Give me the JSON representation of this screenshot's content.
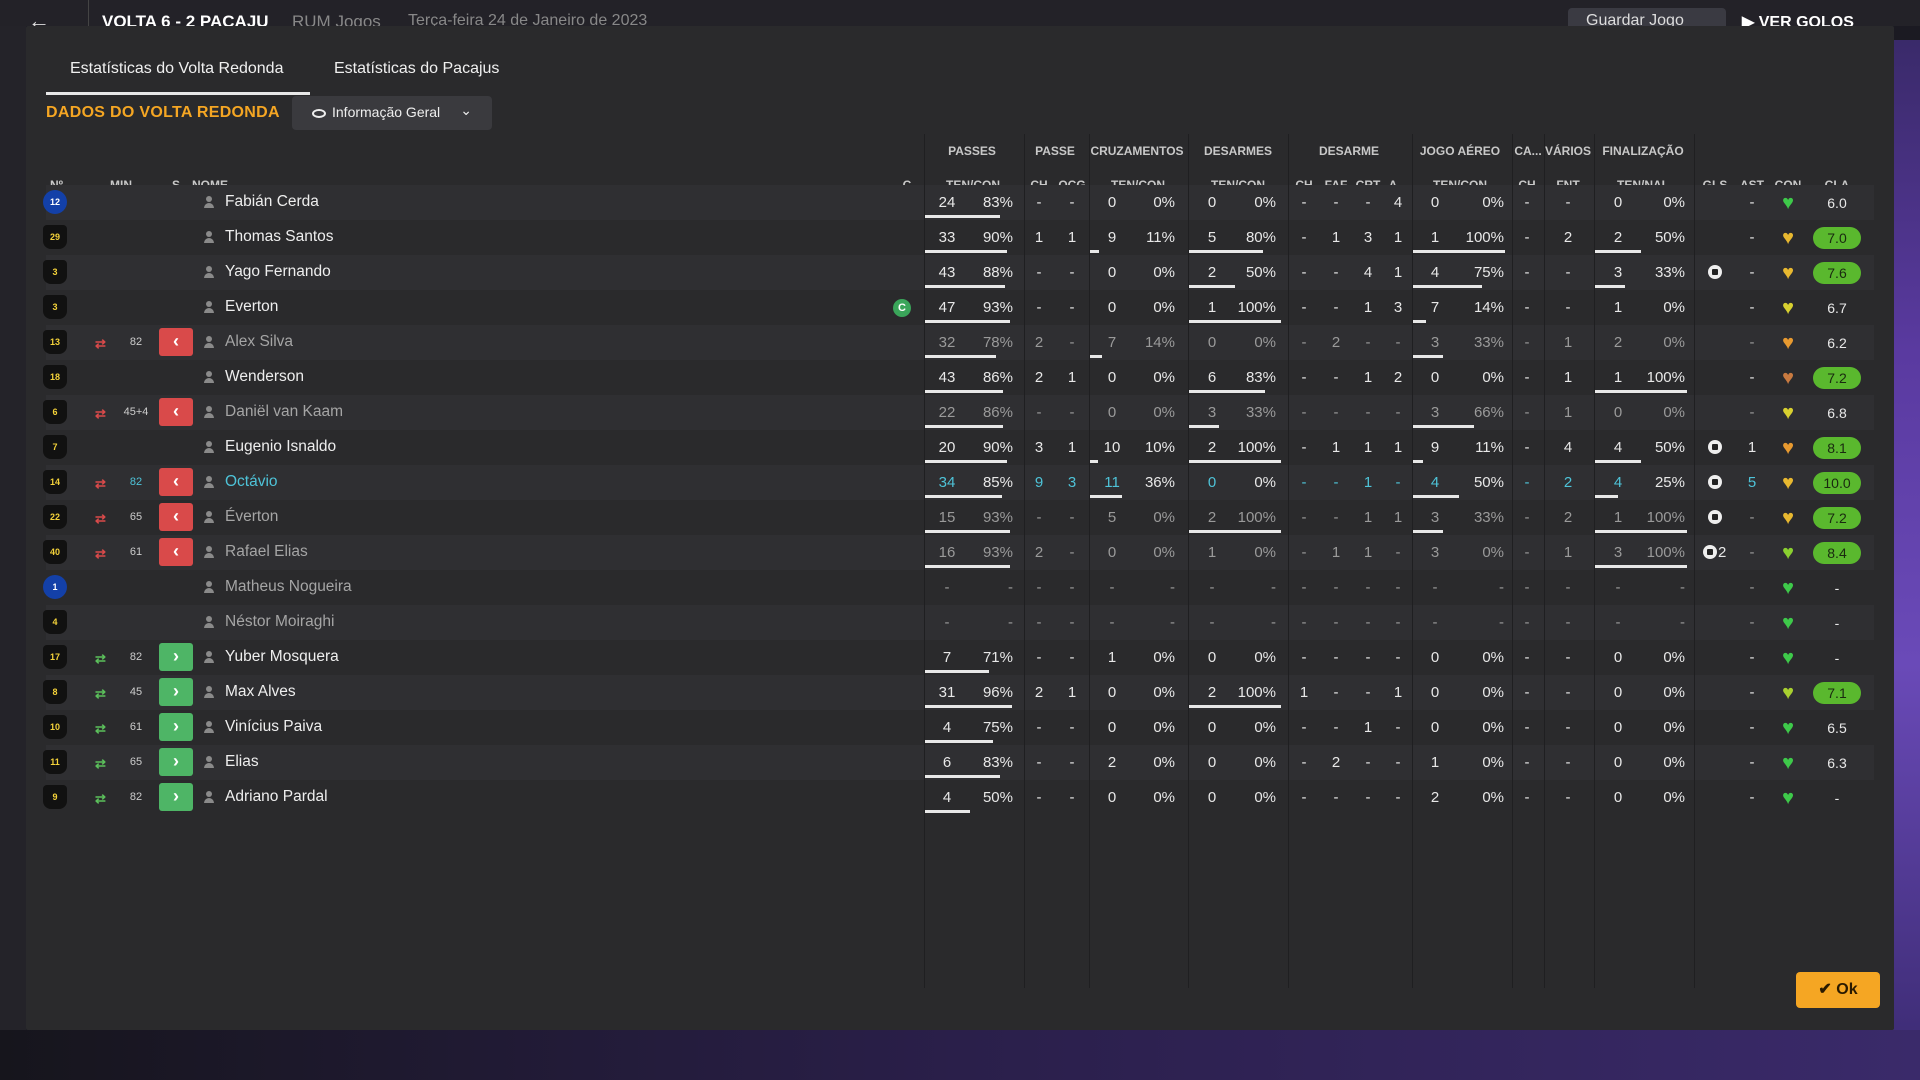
{
  "topbar": {
    "match": "VOLTA 6 - 2 PACAJU",
    "play_type": "RUM Jogos",
    "date": "Terça-feira 24 de Janeiro de 2023",
    "save_label": "Guardar Jogo",
    "watch_label": "VER GOLOS"
  },
  "tabs": [
    "Estatísticas do Volta Redonda",
    "Estatísticas do Pacajus"
  ],
  "section_title": "DADOS DO VOLTA REDONDA",
  "view_select": "Informação Geral",
  "group_headers": [
    "PASSES",
    "PASSE",
    "CRUZAMENTOS",
    "DESARMES",
    "DESARME",
    "JOGO AÉREO",
    "CA...",
    "VÁRIOS",
    "FINALIZAÇÃO"
  ],
  "sub_headers": {
    "no": "Nº",
    "min": "MIN",
    "s": "S",
    "name": "NOME",
    "c": "C",
    "passes": "TEN/CON",
    "pch": "CH",
    "pocg": "OCG",
    "cross": "TEN/CON",
    "tackles": "TEN/CON",
    "dch": "CH",
    "dfaf": "FAF",
    "dcrt": "CRT",
    "da": "A...",
    "aerial": "TEN/CON",
    "cach": "CH",
    "fnt": "FNT",
    "shots": "TEN/NAL",
    "gls": "GLS",
    "ast": "AST",
    "con": "CON",
    "cla": "CLA"
  },
  "ok_label": "Ok",
  "colors": {
    "accent": "#f5a623",
    "highlight": "#4ec3d8",
    "sub_out": "#d94a4a",
    "sub_in": "#4eb566",
    "rating_good": "#5ab82e"
  },
  "players": [
    {
      "no": "12",
      "shirt": "b",
      "min": "",
      "sub": "",
      "name": "Fabián Cerda",
      "dim": false,
      "hl": false,
      "captain": false,
      "pt": "24",
      "pp": "83%",
      "pf": 83,
      "pch": "-",
      "pocg": "-",
      "ct": "0",
      "cp": "0%",
      "cf": 0,
      "tt": "0",
      "tp": "0%",
      "tf": 0,
      "dch": "-",
      "dfaf": "-",
      "dcrt": "-",
      "da": "4",
      "at": "0",
      "ap": "0%",
      "af": 0,
      "cach": "-",
      "fnt": "-",
      "st": "0",
      "sp": "0%",
      "sf": 0,
      "gls": "",
      "ast": "-",
      "heart": "#3ec94a",
      "rating": "6.0",
      "rg": false
    },
    {
      "no": "29",
      "shirt": "y",
      "min": "",
      "sub": "",
      "name": "Thomas Santos",
      "dim": false,
      "hl": false,
      "captain": false,
      "pt": "33",
      "pp": "90%",
      "pf": 90,
      "pch": "1",
      "pocg": "1",
      "ct": "9",
      "cp": "11%",
      "cf": 11,
      "tt": "5",
      "tp": "80%",
      "tf": 80,
      "dch": "-",
      "dfaf": "1",
      "dcrt": "3",
      "da": "1",
      "at": "1",
      "ap": "100%",
      "af": 100,
      "cach": "-",
      "fnt": "2",
      "st": "2",
      "sp": "50%",
      "sf": 50,
      "gls": "",
      "ast": "-",
      "heart": "#e8b830",
      "rating": "7.0",
      "rg": true
    },
    {
      "no": "3",
      "shirt": "y",
      "min": "",
      "sub": "",
      "name": "Yago Fernando",
      "dim": false,
      "hl": false,
      "captain": false,
      "pt": "43",
      "pp": "88%",
      "pf": 88,
      "pch": "-",
      "pocg": "-",
      "ct": "0",
      "cp": "0%",
      "cf": 0,
      "tt": "2",
      "tp": "50%",
      "tf": 50,
      "dch": "-",
      "dfaf": "-",
      "dcrt": "4",
      "da": "1",
      "at": "4",
      "ap": "75%",
      "af": 75,
      "cach": "-",
      "fnt": "-",
      "st": "3",
      "sp": "33%",
      "sf": 33,
      "gls": "ball",
      "ast": "-",
      "heart": "#e8b830",
      "rating": "7.6",
      "rg": true
    },
    {
      "no": "3",
      "shirt": "y",
      "min": "",
      "sub": "",
      "name": "Everton",
      "dim": false,
      "hl": false,
      "captain": true,
      "pt": "47",
      "pp": "93%",
      "pf": 93,
      "pch": "-",
      "pocg": "-",
      "ct": "0",
      "cp": "0%",
      "cf": 0,
      "tt": "1",
      "tp": "100%",
      "tf": 100,
      "dch": "-",
      "dfaf": "-",
      "dcrt": "1",
      "da": "3",
      "at": "7",
      "ap": "14%",
      "af": 14,
      "cach": "-",
      "fnt": "-",
      "st": "1",
      "sp": "0%",
      "sf": 0,
      "gls": "",
      "ast": "-",
      "heart": "#d8d030",
      "rating": "6.7",
      "rg": false
    },
    {
      "no": "13",
      "shirt": "y",
      "min": "82",
      "sub": "out",
      "name": "Alex Silva",
      "dim": true,
      "hl": false,
      "captain": false,
      "pt": "32",
      "pp": "78%",
      "pf": 78,
      "pch": "2",
      "pocg": "-",
      "ct": "7",
      "cp": "14%",
      "cf": 14,
      "tt": "0",
      "tp": "0%",
      "tf": 0,
      "dch": "-",
      "dfaf": "2",
      "dcrt": "-",
      "da": "-",
      "at": "3",
      "ap": "33%",
      "af": 33,
      "cach": "-",
      "fnt": "1",
      "st": "2",
      "sp": "0%",
      "sf": 0,
      "gls": "",
      "ast": "-",
      "heart": "#e89a30",
      "rating": "6.2",
      "rg": false
    },
    {
      "no": "18",
      "shirt": "y",
      "min": "",
      "sub": "",
      "name": "Wenderson",
      "dim": false,
      "hl": false,
      "captain": false,
      "pt": "43",
      "pp": "86%",
      "pf": 86,
      "pch": "2",
      "pocg": "1",
      "ct": "0",
      "cp": "0%",
      "cf": 0,
      "tt": "6",
      "tp": "83%",
      "tf": 83,
      "dch": "-",
      "dfaf": "-",
      "dcrt": "1",
      "da": "2",
      "at": "0",
      "ap": "0%",
      "af": 0,
      "cach": "-",
      "fnt": "1",
      "st": "1",
      "sp": "100%",
      "sf": 100,
      "gls": "",
      "ast": "-",
      "heart": "#c87a40",
      "rating": "7.2",
      "rg": true
    },
    {
      "no": "6",
      "shirt": "y",
      "min": "45+4",
      "sub": "out",
      "name": "Daniël van Kaam",
      "dim": true,
      "hl": false,
      "captain": false,
      "pt": "22",
      "pp": "86%",
      "pf": 86,
      "pch": "-",
      "pocg": "-",
      "ct": "0",
      "cp": "0%",
      "cf": 0,
      "tt": "3",
      "tp": "33%",
      "tf": 33,
      "dch": "-",
      "dfaf": "-",
      "dcrt": "-",
      "da": "-",
      "at": "3",
      "ap": "66%",
      "af": 66,
      "cach": "-",
      "fnt": "1",
      "st": "0",
      "sp": "0%",
      "sf": 0,
      "gls": "",
      "ast": "-",
      "heart": "#d8d030",
      "rating": "6.8",
      "rg": false
    },
    {
      "no": "7",
      "shirt": "y",
      "min": "",
      "sub": "",
      "name": "Eugenio Isnaldo",
      "dim": false,
      "hl": false,
      "captain": false,
      "pt": "20",
      "pp": "90%",
      "pf": 90,
      "pch": "3",
      "pocg": "1",
      "ct": "10",
      "cp": "10%",
      "cf": 10,
      "tt": "2",
      "tp": "100%",
      "tf": 100,
      "dch": "-",
      "dfaf": "1",
      "dcrt": "1",
      "da": "1",
      "at": "9",
      "ap": "11%",
      "af": 11,
      "cach": "-",
      "fnt": "4",
      "st": "4",
      "sp": "50%",
      "sf": 50,
      "gls": "ball",
      "ast": "1",
      "heart": "#e89a30",
      "rating": "8.1",
      "rg": true
    },
    {
      "no": "14",
      "shirt": "y",
      "min": "82",
      "sub": "out",
      "name": "Octávio",
      "dim": false,
      "hl": true,
      "captain": false,
      "pt": "34",
      "pp": "85%",
      "pf": 85,
      "pch": "9",
      "pocg": "3",
      "ct": "11",
      "cp": "36%",
      "cf": 36,
      "tt": "0",
      "tp": "0%",
      "tf": 0,
      "dch": "-",
      "dfaf": "-",
      "dcrt": "1",
      "da": "-",
      "at": "4",
      "ap": "50%",
      "af": 50,
      "cach": "-",
      "fnt": "2",
      "st": "4",
      "sp": "25%",
      "sf": 25,
      "gls": "ball",
      "ast": "5",
      "heart": "#e8b830",
      "rating": "10.0",
      "rg": true
    },
    {
      "no": "22",
      "shirt": "y",
      "min": "65",
      "sub": "out",
      "name": "Éverton",
      "dim": true,
      "hl": false,
      "captain": false,
      "pt": "15",
      "pp": "93%",
      "pf": 93,
      "pch": "-",
      "pocg": "-",
      "ct": "5",
      "cp": "0%",
      "cf": 0,
      "tt": "2",
      "tp": "100%",
      "tf": 100,
      "dch": "-",
      "dfaf": "-",
      "dcrt": "1",
      "da": "1",
      "at": "3",
      "ap": "33%",
      "af": 33,
      "cach": "-",
      "fnt": "2",
      "st": "1",
      "sp": "100%",
      "sf": 100,
      "gls": "ball",
      "ast": "-",
      "heart": "#e8b830",
      "rating": "7.2",
      "rg": true
    },
    {
      "no": "40",
      "shirt": "y",
      "min": "61",
      "sub": "out",
      "name": "Rafael Elias",
      "dim": true,
      "hl": false,
      "captain": false,
      "pt": "16",
      "pp": "93%",
      "pf": 93,
      "pch": "2",
      "pocg": "-",
      "ct": "0",
      "cp": "0%",
      "cf": 0,
      "tt": "1",
      "tp": "0%",
      "tf": 0,
      "dch": "-",
      "dfaf": "1",
      "dcrt": "1",
      "da": "-",
      "at": "3",
      "ap": "0%",
      "af": 0,
      "cach": "-",
      "fnt": "1",
      "st": "3",
      "sp": "100%",
      "sf": 100,
      "gls": "ball2",
      "ast": "-",
      "heart": "#8ad030",
      "rating": "8.4",
      "rg": true
    },
    {
      "no": "1",
      "shirt": "b",
      "min": "",
      "sub": "",
      "name": "Matheus Nogueira",
      "dim": true,
      "hl": false,
      "captain": false,
      "pt": "-",
      "pp": "-",
      "pf": 0,
      "pch": "-",
      "pocg": "-",
      "ct": "-",
      "cp": "-",
      "cf": 0,
      "tt": "-",
      "tp": "-",
      "tf": 0,
      "dch": "-",
      "dfaf": "-",
      "dcrt": "-",
      "da": "-",
      "at": "-",
      "ap": "-",
      "af": 0,
      "cach": "-",
      "fnt": "-",
      "st": "-",
      "sp": "-",
      "sf": 0,
      "gls": "",
      "ast": "-",
      "heart": "#3ec94a",
      "rating": "-",
      "rg": false
    },
    {
      "no": "4",
      "shirt": "y",
      "min": "",
      "sub": "",
      "name": "Néstor Moiraghi",
      "dim": true,
      "hl": false,
      "captain": false,
      "pt": "-",
      "pp": "-",
      "pf": 0,
      "pch": "-",
      "pocg": "-",
      "ct": "-",
      "cp": "-",
      "cf": 0,
      "tt": "-",
      "tp": "-",
      "tf": 0,
      "dch": "-",
      "dfaf": "-",
      "dcrt": "-",
      "da": "-",
      "at": "-",
      "ap": "-",
      "af": 0,
      "cach": "-",
      "fnt": "-",
      "st": "-",
      "sp": "-",
      "sf": 0,
      "gls": "",
      "ast": "-",
      "heart": "#3ec94a",
      "rating": "-",
      "rg": false
    },
    {
      "no": "17",
      "shirt": "y",
      "min": "82",
      "sub": "in",
      "name": "Yuber Mosquera",
      "dim": false,
      "hl": false,
      "captain": false,
      "pt": "7",
      "pp": "71%",
      "pf": 71,
      "pch": "-",
      "pocg": "-",
      "ct": "1",
      "cp": "0%",
      "cf": 0,
      "tt": "0",
      "tp": "0%",
      "tf": 0,
      "dch": "-",
      "dfaf": "-",
      "dcrt": "-",
      "da": "-",
      "at": "0",
      "ap": "0%",
      "af": 0,
      "cach": "-",
      "fnt": "-",
      "st": "0",
      "sp": "0%",
      "sf": 0,
      "gls": "",
      "ast": "-",
      "heart": "#3ec94a",
      "rating": "-",
      "rg": false
    },
    {
      "no": "8",
      "shirt": "y",
      "min": "45",
      "sub": "in",
      "name": "Max Alves",
      "dim": false,
      "hl": false,
      "captain": false,
      "pt": "31",
      "pp": "96%",
      "pf": 96,
      "pch": "2",
      "pocg": "1",
      "ct": "0",
      "cp": "0%",
      "cf": 0,
      "tt": "2",
      "tp": "100%",
      "tf": 100,
      "dch": "1",
      "dfaf": "-",
      "dcrt": "-",
      "da": "1",
      "at": "0",
      "ap": "0%",
      "af": 0,
      "cach": "-",
      "fnt": "-",
      "st": "0",
      "sp": "0%",
      "sf": 0,
      "gls": "",
      "ast": "-",
      "heart": "#a8d030",
      "rating": "7.1",
      "rg": true
    },
    {
      "no": "10",
      "shirt": "y",
      "min": "61",
      "sub": "in",
      "name": "Vinícius Paiva",
      "dim": false,
      "hl": false,
      "captain": false,
      "pt": "4",
      "pp": "75%",
      "pf": 75,
      "pch": "-",
      "pocg": "-",
      "ct": "0",
      "cp": "0%",
      "cf": 0,
      "tt": "0",
      "tp": "0%",
      "tf": 0,
      "dch": "-",
      "dfaf": "-",
      "dcrt": "1",
      "da": "-",
      "at": "0",
      "ap": "0%",
      "af": 0,
      "cach": "-",
      "fnt": "-",
      "st": "0",
      "sp": "0%",
      "sf": 0,
      "gls": "",
      "ast": "-",
      "heart": "#3ec94a",
      "rating": "6.5",
      "rg": false
    },
    {
      "no": "11",
      "shirt": "y",
      "min": "65",
      "sub": "in",
      "name": "Elias",
      "dim": false,
      "hl": false,
      "captain": false,
      "pt": "6",
      "pp": "83%",
      "pf": 83,
      "pch": "-",
      "pocg": "-",
      "ct": "2",
      "cp": "0%",
      "cf": 0,
      "tt": "0",
      "tp": "0%",
      "tf": 0,
      "dch": "-",
      "dfaf": "2",
      "dcrt": "-",
      "da": "-",
      "at": "1",
      "ap": "0%",
      "af": 0,
      "cach": "-",
      "fnt": "-",
      "st": "0",
      "sp": "0%",
      "sf": 0,
      "gls": "",
      "ast": "-",
      "heart": "#3ec94a",
      "rating": "6.3",
      "rg": false
    },
    {
      "no": "9",
      "shirt": "y",
      "min": "82",
      "sub": "in",
      "name": "Adriano Pardal",
      "dim": false,
      "hl": false,
      "captain": false,
      "pt": "4",
      "pp": "50%",
      "pf": 50,
      "pch": "-",
      "pocg": "-",
      "ct": "0",
      "cp": "0%",
      "cf": 0,
      "tt": "0",
      "tp": "0%",
      "tf": 0,
      "dch": "-",
      "dfaf": "-",
      "dcrt": "-",
      "da": "-",
      "at": "2",
      "ap": "0%",
      "af": 0,
      "cach": "-",
      "fnt": "-",
      "st": "0",
      "sp": "0%",
      "sf": 0,
      "gls": "",
      "ast": "-",
      "heart": "#3ec94a",
      "rating": "-",
      "rg": false
    }
  ]
}
